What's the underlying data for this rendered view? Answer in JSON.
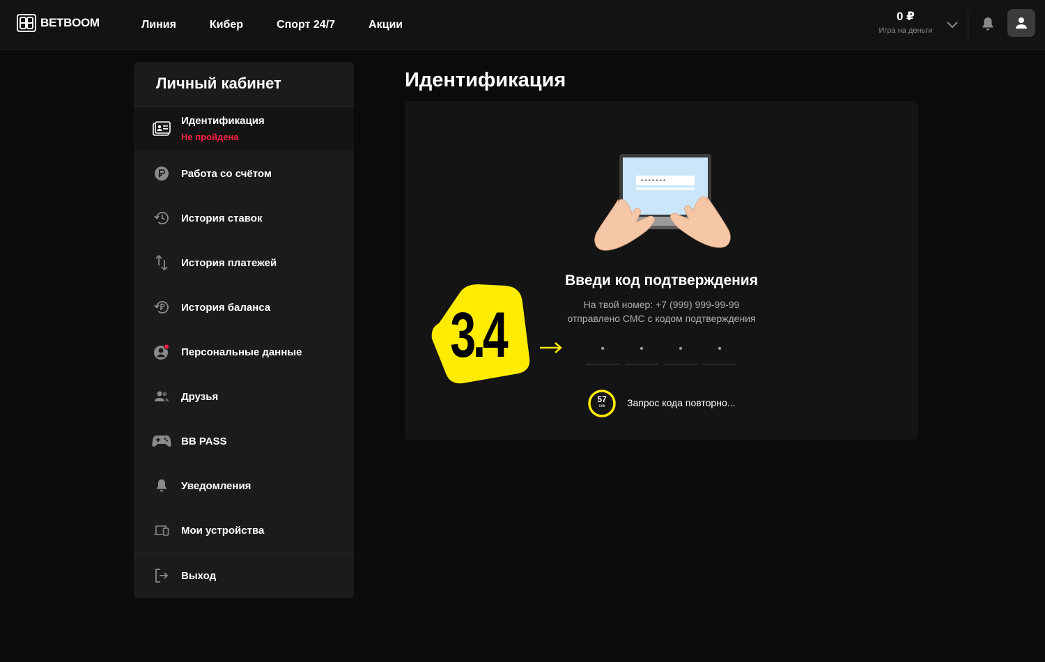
{
  "brand": {
    "name": "BETBOOM"
  },
  "nav": {
    "items": [
      {
        "label": "Линия"
      },
      {
        "label": "Кибер"
      },
      {
        "label": "Спорт 24/7"
      },
      {
        "label": "Акции"
      }
    ]
  },
  "account": {
    "balance": "0 ₽",
    "balance_caption": "Игра на деньги",
    "icons": [
      "chevron-down-icon",
      "bell-icon",
      "user-icon"
    ]
  },
  "sidebar": {
    "title": "Личный кабинет",
    "identification": {
      "label": "Идентификация",
      "status": "Не пройдена",
      "status_color": "#ff1f43",
      "icon": "id-card-icon"
    },
    "items": [
      {
        "label": "Работа со счётом",
        "icon": "ruble-coin-icon"
      },
      {
        "label": "История ставок",
        "icon": "history-icon"
      },
      {
        "label": "История платежей",
        "icon": "transfer-arrows-icon"
      },
      {
        "label": "История баланса",
        "icon": "balance-history-icon"
      },
      {
        "label": "Персональные данные",
        "icon": "user-circle-icon"
      },
      {
        "label": "Друзья",
        "icon": "friends-icon"
      },
      {
        "label": "BB PASS",
        "icon": "gamepad-icon"
      },
      {
        "label": "Уведомления",
        "icon": "bell-icon"
      },
      {
        "label": "Мои устройства",
        "icon": "devices-icon"
      }
    ],
    "logout": {
      "label": "Выход",
      "icon": "logout-icon"
    }
  },
  "main": {
    "title": "Идентификация",
    "heading": "Введи код подтверждения",
    "description_line1": "На твой номер: +7 (999) 999-99-99",
    "description_line2": "отправлено СМС с кодом подтверждения",
    "code_placeholder": [
      "•",
      "•",
      "•",
      "•"
    ],
    "timer_value": "57",
    "timer_unit": "сек",
    "resend_text": "Запрос кода повторно..."
  },
  "overlay": {
    "step": "3.4",
    "accent_color": "#ffec00"
  },
  "colors": {
    "background": "#0b0b0b",
    "header": "#131313",
    "sidebar": "#1b1b1b",
    "card": "#141414",
    "accent": "#ffec00",
    "error": "#ff1f43"
  }
}
